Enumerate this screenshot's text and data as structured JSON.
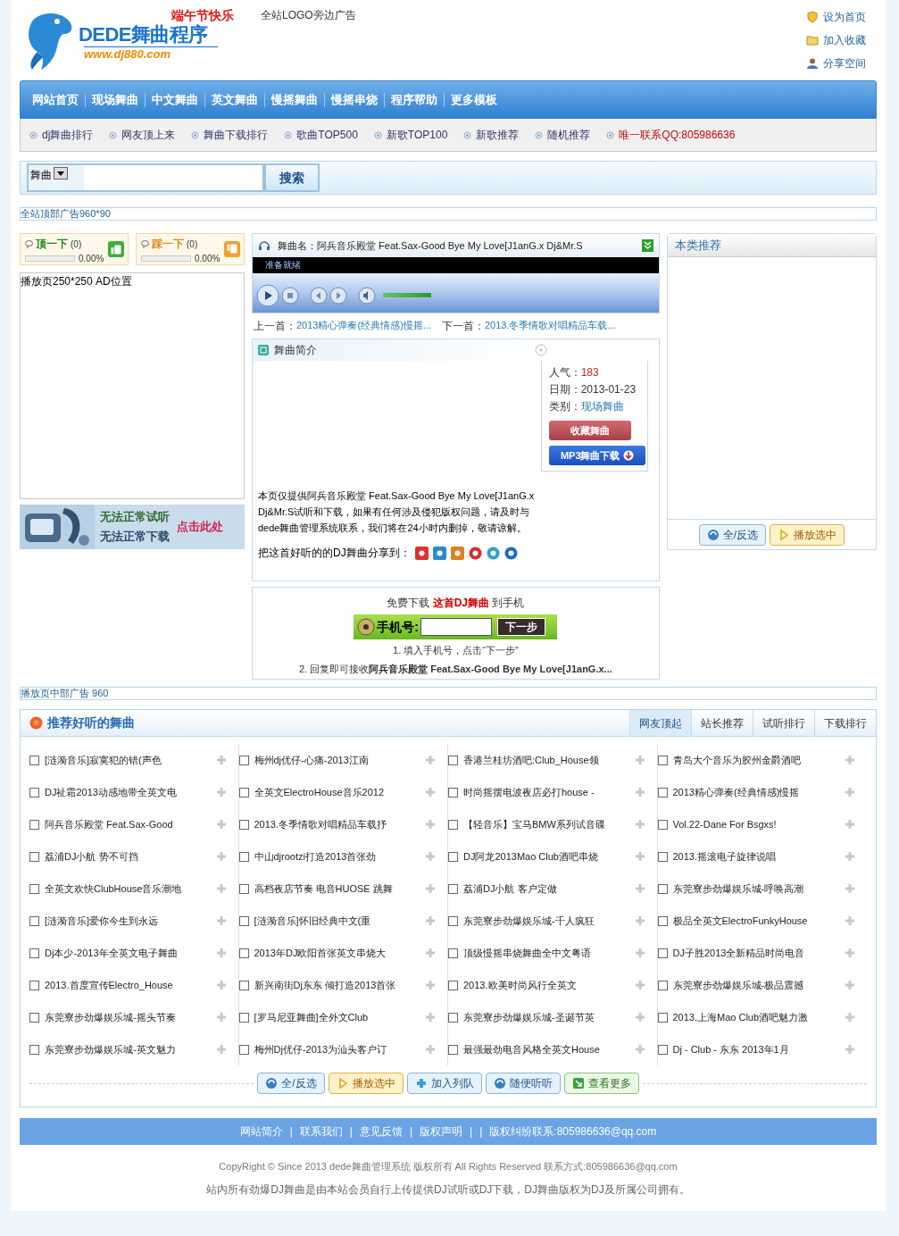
{
  "header": {
    "logo_text": "DEDE舞曲程序",
    "logo_url": "www.dj880.com",
    "festival": "端午节快乐",
    "ad": "全站LOGO旁边广告",
    "links": [
      "设为首页",
      "加入收藏",
      "分享空间"
    ]
  },
  "nav": [
    "网站首页",
    "现场舞曲",
    "中文舞曲",
    "英文舞曲",
    "慢摇舞曲",
    "慢摇串烧",
    "程序帮助",
    "更多模板"
  ],
  "subnav": [
    {
      "label": "dj舞曲排行",
      "kind": "link"
    },
    {
      "label": "网友顶上来",
      "kind": "link"
    },
    {
      "label": "舞曲下载排行",
      "kind": "link"
    },
    {
      "label": "歌曲TOP500",
      "kind": "link"
    },
    {
      "label": "新歌TOP100",
      "kind": "link"
    },
    {
      "label": "新歌推荐",
      "kind": "link"
    },
    {
      "label": "随机推荐",
      "kind": "link"
    },
    {
      "label": "唯一联系QQ:805986636",
      "kind": "contact"
    }
  ],
  "search": {
    "category": "舞曲",
    "button": "搜索"
  },
  "top_ad": "全站顶部广告960*90",
  "votes": [
    {
      "kind": "up",
      "label": "顶一下",
      "count": "(0)",
      "percent": "0.00%",
      "level": 0
    },
    {
      "kind": "down",
      "label": "踩一下",
      "count": "(0)",
      "percent": "0.00%",
      "level": 0
    }
  ],
  "side_ad": "播放页250*250 AD位置",
  "banner": {
    "line1": "无法正常试听",
    "line2": "无法正常下载",
    "action": "点击此处"
  },
  "player": {
    "title": "舞曲名：阿兵音乐殿堂 Feat.Sax-Good Bye My Love[J1anG.x Dj&Mr.S",
    "status": "准备就绪",
    "volume": {
      "level": 0.9
    }
  },
  "prev_next": [
    {
      "label": "上一首：",
      "title": "2013精心弹奏(经典情感)慢摇..."
    },
    {
      "label": "下一首：",
      "title": "2013.冬季情歌对唱精品车载..."
    }
  ],
  "intro": {
    "title": "舞曲简介",
    "info": [
      {
        "label": "人气：",
        "value": "183",
        "kind": "count"
      },
      {
        "label": "日期：",
        "value": "2013-01-23",
        "kind": "plain"
      },
      {
        "label": "类别：",
        "value": "现场舞曲",
        "kind": "link"
      }
    ],
    "buttons": [
      {
        "kind": "favorite",
        "label": "收藏舞曲"
      },
      {
        "kind": "download",
        "label": "MP3舞曲下载"
      }
    ],
    "disclaimer": "本页仅提供阿兵音乐殿堂 Feat.Sax-Good Bye My Love[J1anG.x Dj&Mr.S试听和下载，如果有任何涉及侵犯版权问题，请及时与dede舞曲管理系统联系，我们将在24小时内删掉，敬请谅解。",
    "share_label": "把这首好听的的DJ舞曲分享到："
  },
  "phone": {
    "heading": "免费下载 **这首DJ舞曲** 到手机",
    "label": "手机号:",
    "button": "下一步",
    "steps": [
      "1. 填入手机号，点击“下一步”",
      "2. 回复即可接收**阿兵音乐殿堂 Feat.Sax-Good Bye My Love[J1anG.x...**"
    ]
  },
  "related": {
    "title": "本类推荐",
    "buttons": [
      {
        "kind": "select",
        "label": "全/反选"
      },
      {
        "kind": "play",
        "label": "播放选中"
      }
    ]
  },
  "mid_ad": "播放页中部广告 960",
  "recommend": {
    "title": "推荐好听的舞曲",
    "tabs": [
      {
        "label": "网友顶起",
        "selected": true
      },
      {
        "label": "站长推荐",
        "selected": false
      },
      {
        "label": "试听排行",
        "selected": false
      },
      {
        "label": "下载排行",
        "selected": false
      }
    ],
    "columns": [
      [
        {
          "title": "[涟漪音乐]寂寞犯的错(声色",
          "checked": false
        },
        {
          "title": "DJ祉霜2013动感地带全英文电",
          "checked": false
        },
        {
          "title": "阿兵音乐殿堂 Feat.Sax-Good",
          "checked": false
        },
        {
          "title": "荔浦DJ小航 势不可挡",
          "checked": false
        },
        {
          "title": "全英文欢快ClubHouse音乐潮地",
          "checked": false
        },
        {
          "title": "[涟漪音乐]爱你今生到永远",
          "checked": false
        },
        {
          "title": "Dj本少-2013年全英文电子舞曲",
          "checked": false
        },
        {
          "title": "2013.首度宣传Electro_House",
          "checked": false
        },
        {
          "title": "东莞寮步劲爆娱乐城-摇头节奏",
          "checked": false
        },
        {
          "title": "东莞寮步劲爆娱乐城-英文魅力",
          "checked": false
        }
      ],
      [
        {
          "title": "梅州dj优仔-心痛-2013江南",
          "checked": false
        },
        {
          "title": "全英文ElectroHouse音乐2012",
          "checked": false
        },
        {
          "title": "2013.冬季情歌对唱精品车载抒",
          "checked": false
        },
        {
          "title": "中山djrootzi打造2013首张劲",
          "checked": false
        },
        {
          "title": "高档夜店节奏 电音HUOSE 跳舞",
          "checked": false
        },
        {
          "title": "[涟漪音乐]怀旧经典中文(重",
          "checked": false
        },
        {
          "title": "2013年DJ欧阳首张英文串烧大",
          "checked": false
        },
        {
          "title": "新兴南街Dj东东 倾打造2013首张",
          "checked": false
        },
        {
          "title": "[罗马尼亚舞曲]全外文Club",
          "checked": false
        },
        {
          "title": "梅州Dj优仔-2013为汕头客户订",
          "checked": false
        }
      ],
      [
        {
          "title": "香港兰桂坊酒吧:Club_House领",
          "checked": false
        },
        {
          "title": "时尚摇摆电波夜店必打house -",
          "checked": false
        },
        {
          "title": "【轻音乐】宝马BMW系列试音碟",
          "checked": false
        },
        {
          "title": "DJ阿龙2013Mao Club酒吧串烧",
          "checked": false
        },
        {
          "title": "荔浦DJ小航 客户定做",
          "checked": false
        },
        {
          "title": "东莞寮步劲爆娱乐城-千人疯狂",
          "checked": false
        },
        {
          "title": "顶级慢摇串烧舞曲全中文粤语",
          "checked": false
        },
        {
          "title": "2013.欧美时尚风行全英文",
          "checked": false
        },
        {
          "title": "东莞寮步劲爆娱乐城-圣诞节英",
          "checked": false
        },
        {
          "title": "最强最劲电音风格全英文House",
          "checked": false
        }
      ],
      [
        {
          "title": "青岛大个音乐为胶州金爵酒吧",
          "checked": false
        },
        {
          "title": "2013精心弹奏(经典情感)慢摇",
          "checked": false
        },
        {
          "title": "Vol.22-Dane For Bsgxs!",
          "checked": false
        },
        {
          "title": "2013.摇滚电子旋律说唱",
          "checked": false
        },
        {
          "title": "东莞寮步劲爆娱乐城-呼唤高潮",
          "checked": false
        },
        {
          "title": "极品全英文ElectroFunkyHouse",
          "checked": false
        },
        {
          "title": "DJ子胜2013全新精品时尚电音",
          "checked": false
        },
        {
          "title": "东莞寮步劲爆娱乐城-极品震撼",
          "checked": false
        },
        {
          "title": "2013.上海Mao Club酒吧魅力激",
          "checked": false
        },
        {
          "title": "Dj - Club - 东东 2013年1月",
          "checked": false
        }
      ]
    ],
    "buttons": [
      {
        "kind": "select",
        "label": "全/反选"
      },
      {
        "kind": "play",
        "label": "播放选中"
      },
      {
        "kind": "queue",
        "label": "加入列队"
      },
      {
        "kind": "random",
        "label": "随便听听"
      },
      {
        "kind": "more",
        "label": "查看更多"
      }
    ]
  },
  "footer": {
    "links": [
      "网站简介",
      "|",
      "联系我们",
      "|",
      "意见反馈",
      "|",
      "版权声明",
      "|",
      "|",
      "版权纠纷联系:805986636@qq.com"
    ],
    "copyright": "CopyRight © Since 2013 dede舞曲管理系统 版权所有 All Rights Reserved 联系方式:805986636@qq.com",
    "notice": "站内所有劲爆DJ舞曲是由本站会员自行上传提供DJ试听或DJ下载，DJ舞曲版权为DJ及所属公司拥有。"
  }
}
